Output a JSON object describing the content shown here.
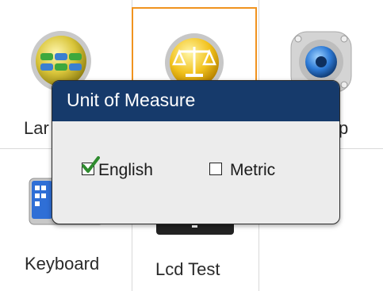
{
  "tiles": {
    "language": {
      "label": "Lar",
      "icon": "globe-icon"
    },
    "units": {
      "icon": "scale-icon"
    },
    "sound": {
      "label": "p",
      "icon": "speaker-icon"
    },
    "keyboard": {
      "label": "Keyboard",
      "icon": "keyboard-icon"
    },
    "lcd_test": {
      "label": "Lcd Test",
      "icon": "display-icon"
    }
  },
  "dialog": {
    "title": "Unit of Measure",
    "options": [
      {
        "label": "English",
        "checked": true
      },
      {
        "label": "Metric",
        "checked": false
      }
    ]
  },
  "colors": {
    "header": "#163a6b",
    "selection_border": "#f0931f",
    "check": "#2e8b2e"
  }
}
